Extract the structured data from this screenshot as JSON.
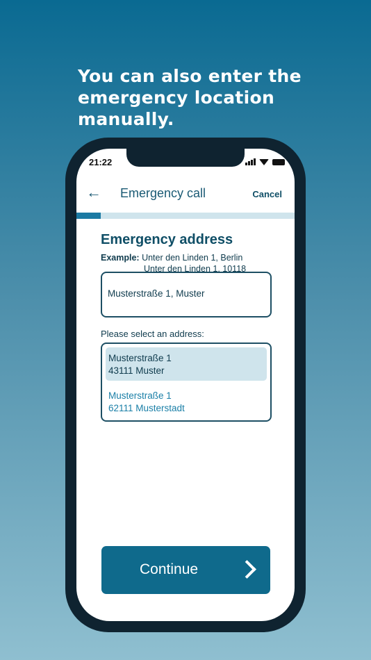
{
  "headline": "You can also enter the emergency location manually.",
  "status": {
    "time": "21:22"
  },
  "appbar": {
    "back_icon": "arrow-left-icon",
    "title": "Emergency call",
    "cancel_label": "Cancel"
  },
  "progress": {
    "fraction": 0.11
  },
  "form": {
    "section_title": "Emergency address",
    "example_label": "Example:",
    "example_line1": "Unter den Linden 1, Berlin",
    "example_line2": "Unter den Linden 1, 10118",
    "address_value": "Musterstraße 1, Muster",
    "select_label": "Please select an address:",
    "options": [
      {
        "street": "Musterstraße 1",
        "city": "43111 Muster"
      },
      {
        "street": "Musterstraße 1",
        "city": "62111 Musterstadt"
      }
    ]
  },
  "continue": {
    "label": "Continue",
    "icon": "chevron-right-icon"
  },
  "colors": {
    "accent": "#0f6a8c",
    "selected_bg": "#cfe4ec",
    "dark_text": "#0f4e66"
  }
}
